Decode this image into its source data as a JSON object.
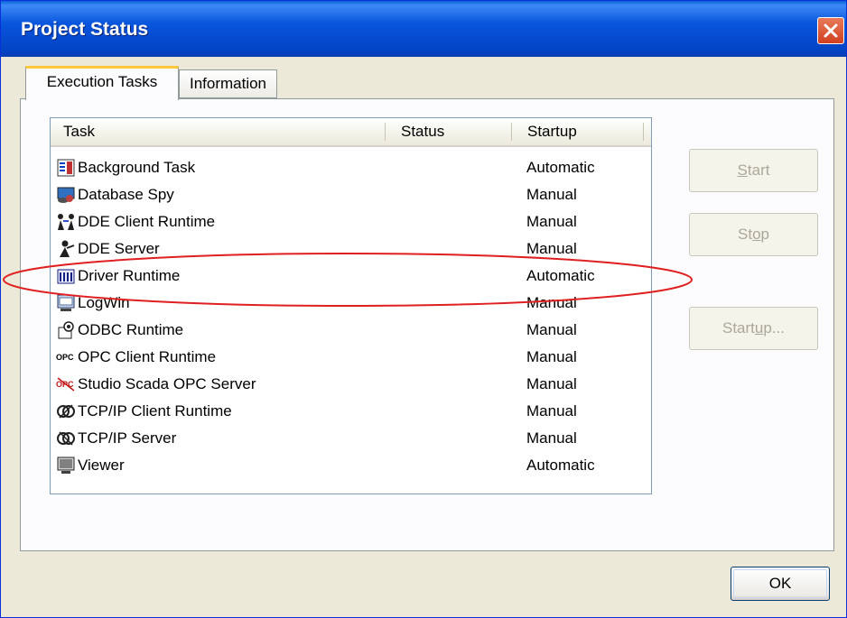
{
  "window": {
    "title": "Project Status"
  },
  "tabs": [
    {
      "label": "Execution Tasks",
      "active": true
    },
    {
      "label": "Information",
      "active": false
    }
  ],
  "list": {
    "columns": [
      "Task",
      "Status",
      "Startup"
    ],
    "rows": [
      {
        "task": "Background Task",
        "status": "",
        "startup": "Automatic",
        "icon": "background-task-icon"
      },
      {
        "task": "Database Spy",
        "status": "",
        "startup": "Manual",
        "icon": "database-spy-icon"
      },
      {
        "task": "DDE Client Runtime",
        "status": "",
        "startup": "Manual",
        "icon": "dde-client-icon"
      },
      {
        "task": "DDE Server",
        "status": "",
        "startup": "Manual",
        "icon": "dde-server-icon"
      },
      {
        "task": "Driver Runtime",
        "status": "",
        "startup": "Automatic",
        "icon": "driver-runtime-icon"
      },
      {
        "task": "LogWin",
        "status": "",
        "startup": "Manual",
        "icon": "logwin-icon"
      },
      {
        "task": "ODBC Runtime",
        "status": "",
        "startup": "Manual",
        "icon": "odbc-runtime-icon"
      },
      {
        "task": "OPC Client Runtime",
        "status": "",
        "startup": "Manual",
        "icon": "opc-client-icon"
      },
      {
        "task": "Studio Scada OPC Server",
        "status": "",
        "startup": "Manual",
        "icon": "opc-server-icon"
      },
      {
        "task": "TCP/IP Client Runtime",
        "status": "",
        "startup": "Manual",
        "icon": "tcpip-client-icon"
      },
      {
        "task": "TCP/IP Server",
        "status": "",
        "startup": "Manual",
        "icon": "tcpip-server-icon"
      },
      {
        "task": "Viewer",
        "status": "",
        "startup": "Automatic",
        "icon": "viewer-icon"
      }
    ]
  },
  "buttons": {
    "start": {
      "pre": "",
      "key": "S",
      "post": "tart",
      "enabled": false
    },
    "stop": {
      "pre": "St",
      "key": "o",
      "post": "p",
      "enabled": false
    },
    "startup": {
      "pre": "Start",
      "key": "u",
      "post": "p...",
      "enabled": false
    },
    "ok": "OK"
  },
  "colors": {
    "title_bar": "#0a5fd8",
    "close_button": "#d0401e",
    "active_tab_accent": "#ffc83c",
    "annotation_ellipse": "#e02020",
    "dialog_face": "#ece9d8"
  }
}
